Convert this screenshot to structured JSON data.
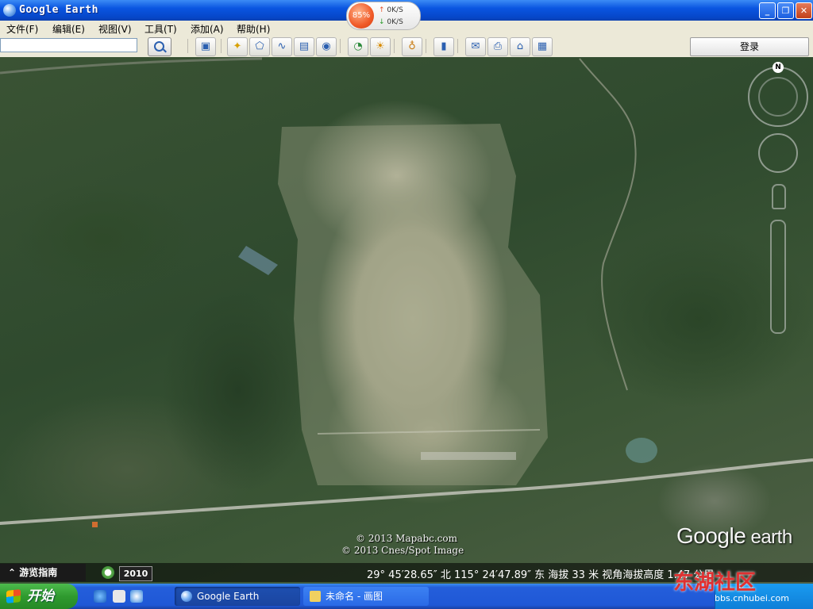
{
  "window": {
    "title": "Google Earth"
  },
  "net_widget": {
    "percent": "85%",
    "up_speed": "0K/S",
    "down_speed": "0K/S"
  },
  "menu": [
    "文件(F)",
    "编辑(E)",
    "视图(V)",
    "工具(T)",
    "添加(A)",
    "帮助(H)"
  ],
  "toolbar": {
    "search_value": "",
    "login_label": "登录"
  },
  "map": {
    "copyright_1": "© 2013 Mapabc.com",
    "copyright_2": "© 2013 Cnes/Spot Image",
    "logo_google": "Google",
    "logo_earth": " earth",
    "compass_label": "N"
  },
  "status": {
    "tour_guide": "游览指南",
    "year": "2010",
    "coordinates": "29° 45′28.65″ 北 115° 24′47.89″ 东 海拔    33 米    视角海拔高度    1.47 公里"
  },
  "taskbar": {
    "start_label": "开始",
    "tasks": [
      "Google Earth",
      "未命名 - 画图"
    ]
  },
  "watermark": {
    "main": "东湖社区",
    "sub": "bbs.cnhubei.com"
  },
  "colors": {
    "title_bar": "#0a55e0",
    "taskbar": "#245edb",
    "start_button": "#2f9a2f",
    "accent_orange": "#f05a28"
  }
}
